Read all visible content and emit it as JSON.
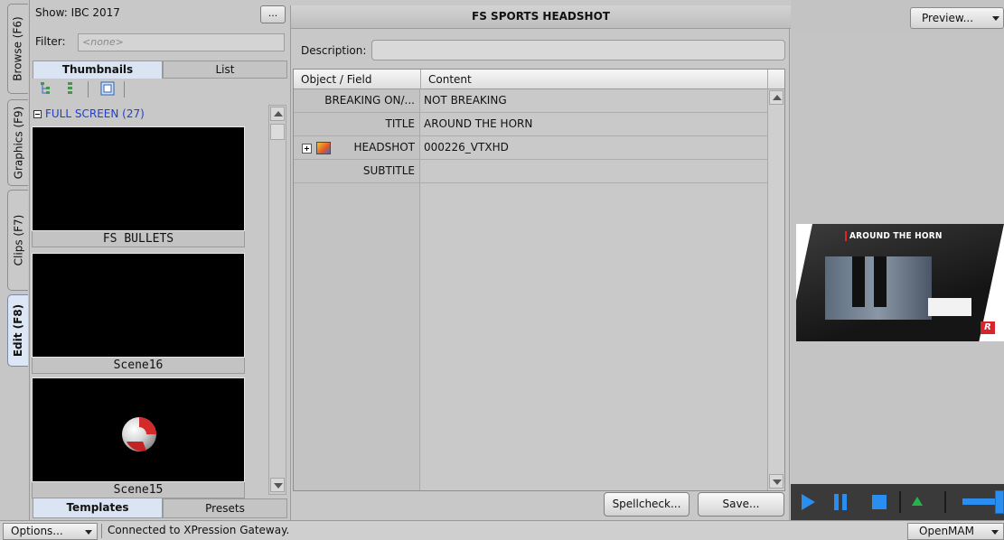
{
  "vtabs": [
    {
      "label": "Browse (F6)",
      "active": false
    },
    {
      "label": "Graphics (F9)",
      "active": false
    },
    {
      "label": "Clips (F7)",
      "active": false
    },
    {
      "label": "Edit (F8)",
      "active": true
    }
  ],
  "left": {
    "show_label": "Show: IBC 2017",
    "dots_label": "...",
    "filter_label": "Filter:",
    "filter_value": "<none>",
    "view_tabs": [
      "Thumbnails",
      "List"
    ],
    "group_label": "FULL SCREEN (27)",
    "thumbs": [
      {
        "caption": "FS BULLETS"
      },
      {
        "caption": "Scene16"
      },
      {
        "caption": "Scene15"
      }
    ],
    "bottom_tabs": [
      "Templates",
      "Presets"
    ]
  },
  "center": {
    "title": "FS SPORTS HEADSHOT",
    "description_label": "Description:",
    "description_value": "",
    "columns": [
      "Object / Field",
      "Content"
    ],
    "rows": [
      {
        "field": "BREAKING ON/...",
        "content": "NOT BREAKING"
      },
      {
        "field": "TITLE",
        "content": "AROUND THE HORN"
      },
      {
        "field": "HEADSHOT",
        "content": "000226_VTXHD"
      },
      {
        "field": "SUBTITLE",
        "content": ""
      }
    ],
    "spellcheck_label": "Spellcheck...",
    "save_label": "Save..."
  },
  "right": {
    "preview_label": "Preview...",
    "preview_title": "AROUND THE HORN",
    "logo_text": "R"
  },
  "status": {
    "options_label": "Options...",
    "message": "Connected to XPression Gateway.",
    "openmam_label": "OpenMAM"
  },
  "colors": {
    "accent_blue": "#2a8ef0",
    "accent_green": "#23b54b",
    "group_blue": "#1e3fcf",
    "brand_red": "#d6262c"
  }
}
